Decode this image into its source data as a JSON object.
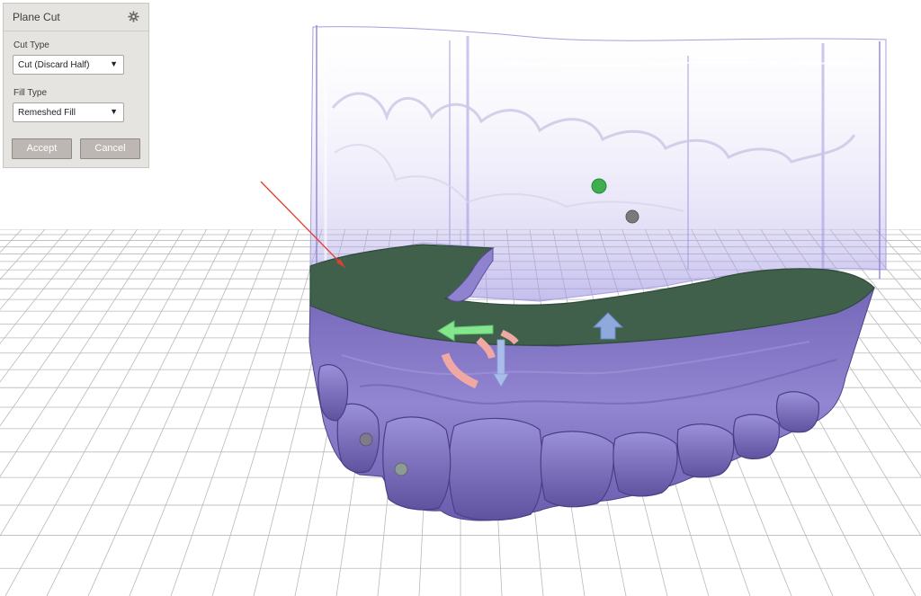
{
  "panel": {
    "title": "Plane Cut",
    "cut_type_label": "Cut Type",
    "cut_type_value": "Cut (Discard Half)",
    "fill_type_label": "Fill Type",
    "fill_type_value": "Remeshed Fill",
    "accept_label": "Accept",
    "cancel_label": "Cancel",
    "settings_icon": "gear-icon"
  },
  "viewport": {
    "colors": {
      "grid_line": "#b9b9b9",
      "model_purple": "#8c7fc9",
      "model_purple_dark": "#5d5197",
      "cut_plane_green": "#3f5f4c",
      "ghost_purple": "#c9c3ee",
      "gizmo_green": "#7ee38b",
      "gizmo_blue": "#9fb3e6",
      "gizmo_red": "#f0a6a4",
      "arrow_red": "#e0402b"
    },
    "markers": [
      "green-point",
      "gray-point",
      "gray-point",
      "gray-point"
    ]
  }
}
